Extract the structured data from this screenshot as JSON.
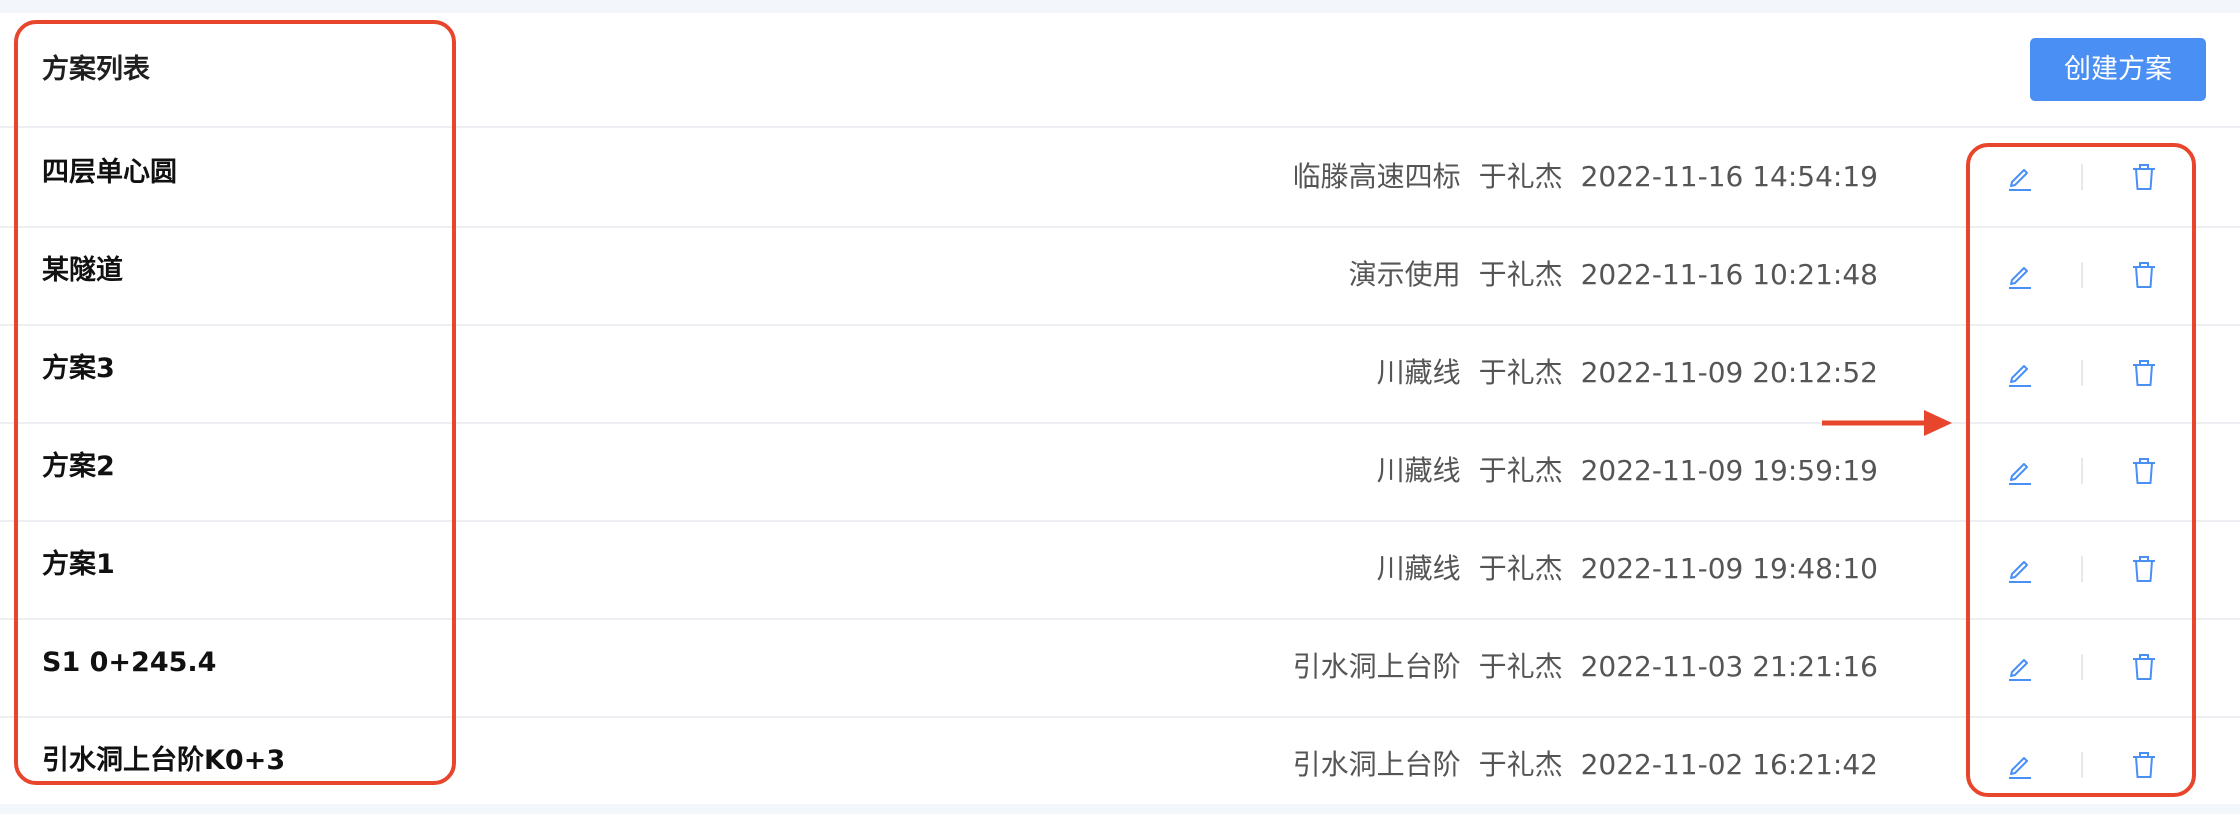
{
  "header": {
    "title": "方案列表",
    "create_button_label": "创建方案"
  },
  "rows": [
    {
      "name": "四层单心圆",
      "project": "临滕高速四标",
      "user": "于礼杰",
      "time": "2022-11-16 14:54:19"
    },
    {
      "name": "某隧道",
      "project": "演示使用",
      "user": "于礼杰",
      "time": "2022-11-16 10:21:48"
    },
    {
      "name": "方案3",
      "project": "川藏线",
      "user": "于礼杰",
      "time": "2022-11-09 20:12:52"
    },
    {
      "name": "方案2",
      "project": "川藏线",
      "user": "于礼杰",
      "time": "2022-11-09 19:59:19"
    },
    {
      "name": "方案1",
      "project": "川藏线",
      "user": "于礼杰",
      "time": "2022-11-09 19:48:10"
    },
    {
      "name": "S1 0+245.4",
      "project": "引水洞上台阶",
      "user": "于礼杰",
      "time": "2022-11-03 21:21:16"
    },
    {
      "name": "引水洞上台阶K0+3",
      "project": "引水洞上台阶",
      "user": "于礼杰",
      "time": "2022-11-02 16:21:42"
    }
  ],
  "icons": {
    "edit": "edit-icon",
    "delete": "trash-icon"
  },
  "colors": {
    "accent": "#4a90f4",
    "annotation": "#e8462c"
  }
}
